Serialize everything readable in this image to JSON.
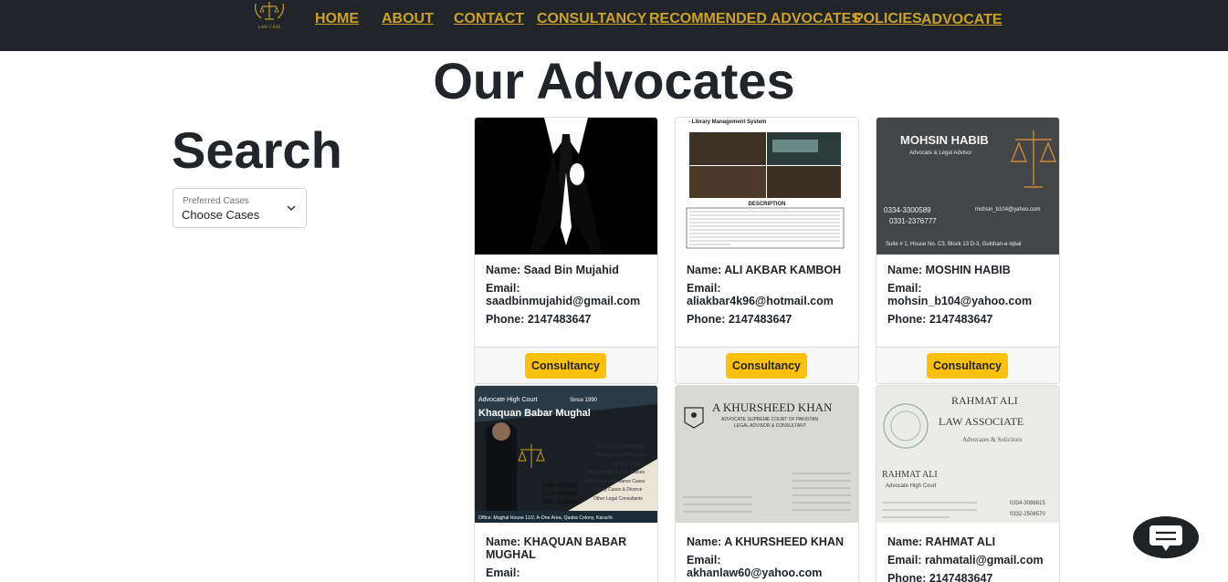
{
  "nav": {
    "logo_text": "LAW CASE",
    "items": [
      {
        "label": "HOME"
      },
      {
        "label": "ABOUT"
      },
      {
        "label": "CONTACT"
      },
      {
        "label": "CONSULTANCY"
      },
      {
        "label": "RECOMMENDED ADVOCATES"
      },
      {
        "label": "POLICIES"
      },
      {
        "label": "ADVOCATE"
      }
    ]
  },
  "page_title": "Our Advocates",
  "search": {
    "title": "Search",
    "select_label": "Preferred Cases",
    "select_value": "Choose Cases"
  },
  "cards": [
    {
      "name_line": "Name: Saad Bin Mujahid",
      "email_label": "Email:",
      "email": "saadbinmujahid@gmail.com",
      "phone_line": "Phone: 2147483647",
      "button": "Consultancy"
    },
    {
      "name_line": "Name: ALI AKBAR KAMBOH",
      "email_label": "Email:",
      "email": "aliakbar4k96@hotmail.com",
      "phone_line": "Phone: 2147483647",
      "button": "Consultancy",
      "image_text": {
        "header": "- Library Management System",
        "caption": "DESCRIPTION"
      }
    },
    {
      "name_line": "Name: MOSHIN HABIB",
      "email_label": "Email:",
      "email": "mohsin_b104@yahoo.com",
      "phone_line": "Phone: 2147483647",
      "button": "Consultancy",
      "image_text": {
        "name": "MOHSIN HABIB",
        "title": "Advocate & Legal Advisor",
        "phone1": "0334-3300589",
        "phone2": "0331-2376777",
        "email": "mohsin_b104@yahoo.com",
        "address": "Suite # 1, House No. C3, Block 13 D-3, Gulshan-e-Iqbal"
      }
    },
    {
      "name_line": "Name: KHAQUAN BABAR MUGHAL",
      "email_label": "Email:",
      "email": "",
      "phone_line": "",
      "button": "Consultancy",
      "image_text": {
        "top": "Advocate High Court",
        "since": "Since 1990",
        "name": "Khaquan Babar Mughal",
        "services_title": "OUR SERVICES",
        "services": [
          "Laws and Legal Matters",
          "Property and Rent Cases",
          "Criminal Cases",
          "Fraud Cases & Civil Abuses",
          "Banking & Inheritance Cases",
          "Family Cases & Divorce",
          "Other Legal Consultants"
        ],
        "contact": "Contact Now",
        "phones": [
          "0335-4510611",
          "0312-4660835",
          "0307-2548296"
        ],
        "office": "Office: Mughal House 11/2, A-One Area, Qasba Colony, Karachi."
      }
    },
    {
      "name_line": "Name: A KHURSHEED KHAN",
      "email_label": "Email:",
      "email": "akhanlaw60@yahoo.com",
      "phone_line": "",
      "button": "Consultancy",
      "image_text": {
        "name": "A KHURSHEED KHAN",
        "line1": "ADVOCATE SUPREME COURT OF PAKISTAN",
        "line2": "LEGAL ADVISOR & CONSULTANT"
      }
    },
    {
      "name_line": "Name: RAHMAT ALI",
      "email_label": "Email: rahmatali@gmail.com",
      "email": "",
      "phone_line": "Phone: 2147483647",
      "button": "Consultancy",
      "image_text": {
        "line1": "RAHMAT ALI",
        "line2": "LAW ASSOCIATE",
        "line3": "Advocates & Solicitors",
        "name": "RAHMAT ALI",
        "title": "Advocate High Court",
        "phone1": "0334-3086815",
        "phone2": "0332-2508570"
      }
    }
  ],
  "colors": {
    "nav_bg": "#212529",
    "nav_link": "#c9a227",
    "button": "#ffc107"
  },
  "chat_icon": "chat-bubble-icon"
}
